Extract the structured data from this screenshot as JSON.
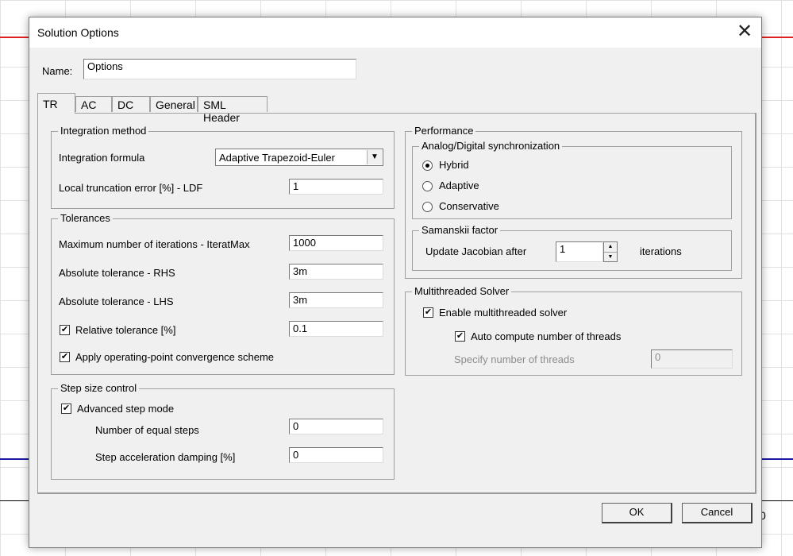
{
  "dialog": {
    "title": "Solution Options",
    "close_glyph": "✕",
    "name_label": "Name:",
    "name_value": "Options",
    "tabs": [
      {
        "label": "TR",
        "active": true
      },
      {
        "label": "AC",
        "active": false
      },
      {
        "label": "DC",
        "active": false
      },
      {
        "label": "General",
        "active": false
      },
      {
        "label": "SML Header",
        "active": false
      }
    ],
    "ok_label": "OK",
    "cancel_label": "Cancel"
  },
  "integration": {
    "group_label": "Integration method",
    "formula_label": "Integration formula",
    "formula_value": "Adaptive Trapezoid-Euler",
    "ltelabel": "Local truncation error [%] - LDF",
    "lte_value": "1"
  },
  "tolerances": {
    "group_label": "Tolerances",
    "iter_label": "Maximum number of iterations - IteratMax",
    "iter_value": "1000",
    "rhs_label": "Absolute tolerance - RHS",
    "rhs_value": "3m",
    "lhs_label": "Absolute tolerance - LHS",
    "lhs_value": "3m",
    "rel_label": "Relative tolerance [%]",
    "rel_checked": true,
    "rel_value": "0.1",
    "opconv_label": "Apply operating-point convergence scheme",
    "opconv_checked": true
  },
  "stepsize": {
    "group_label": "Step size control",
    "adv_label": "Advanced step mode",
    "adv_checked": true,
    "equal_label": "Number of equal steps",
    "equal_value": "0",
    "damp_label": "Step acceleration damping [%]",
    "damp_value": "0"
  },
  "performance": {
    "group_label": "Performance",
    "sync_label": "Analog/Digital synchronization",
    "sync_options": [
      {
        "label": "Hybrid",
        "selected": true
      },
      {
        "label": "Adaptive",
        "selected": false
      },
      {
        "label": "Conservative",
        "selected": false
      }
    ],
    "samanskii_label": "Samanskii factor",
    "jacobian_label": "Update Jacobian after",
    "jacobian_value": "1",
    "iterations_label": "iterations"
  },
  "multithread": {
    "group_label": "Multithreaded Solver",
    "enable_label": "Enable multithreaded solver",
    "enable_checked": true,
    "auto_label": "Auto compute number of threads",
    "auto_checked": true,
    "specify_label": "Specify number of threads",
    "specify_value": "0"
  },
  "background": {
    "partial_text": "0"
  }
}
